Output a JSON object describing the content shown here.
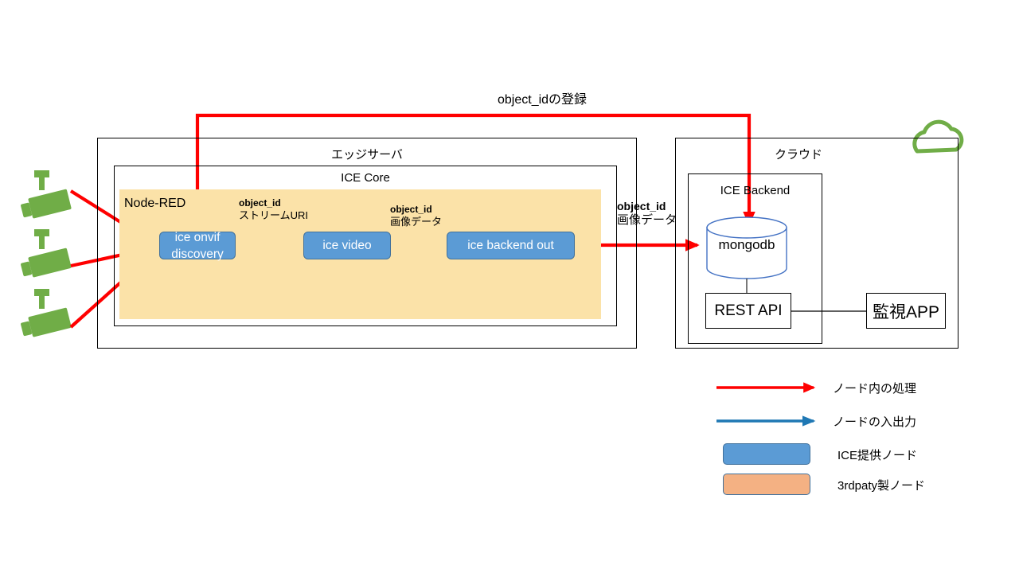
{
  "diagram": {
    "title_top_arrow": "object_idの登録",
    "edge_server": {
      "label": "エッジサーバ"
    },
    "ice_core": {
      "label": "ICE Core"
    },
    "node_red": {
      "label": "Node-RED"
    },
    "cloud": {
      "label": "クラウド"
    },
    "ice_backend": {
      "label": "ICE Backend"
    },
    "nodes": [
      {
        "id": "ice-onvif-discovery",
        "line1": "ice onvif",
        "line2": "discovery"
      },
      {
        "id": "ice-video",
        "line1": "ice video",
        "line2": ""
      },
      {
        "id": "ice-backend-out",
        "line1": "ice backend out",
        "line2": ""
      }
    ],
    "flow_labels": [
      {
        "id": "label-stream",
        "line1": "object_id",
        "line2": "ストリームURI"
      },
      {
        "id": "label-image",
        "line1": "object_id",
        "line2": "画像データ"
      },
      {
        "id": "label-image-out",
        "line1": "object_id",
        "line2": "画像データ"
      }
    ],
    "database": {
      "label": "mongodb"
    },
    "rest_api": {
      "label": "REST API"
    },
    "monitor_app": {
      "label": "監視APP"
    },
    "cameras": [
      {
        "id": "camera-1"
      },
      {
        "id": "camera-2"
      },
      {
        "id": "camera-3"
      }
    ]
  },
  "legend": {
    "items": [
      {
        "id": "legend-red-arrow",
        "kind": "arrow",
        "color": "#FF0000",
        "label": "ノード内の処理"
      },
      {
        "id": "legend-blue-arrow",
        "kind": "arrow",
        "color": "#1F78B4",
        "label": "ノードの入出力"
      },
      {
        "id": "legend-blue-swatch",
        "kind": "swatch",
        "color": "#5B9BD5",
        "label": "ICE提供ノード"
      },
      {
        "id": "legend-orange-swatch",
        "kind": "swatch",
        "color": "#F4B183",
        "label": "3rdpaty製ノード"
      }
    ]
  },
  "colors": {
    "node_blue": "#5B9BD5",
    "node_orange": "#F4B183",
    "red_arrow": "#FF0000",
    "blue_arrow": "#1F78B4",
    "yellow_area": "#FBE2A8",
    "camera_green": "#70AD47",
    "cloud_green": "#70AD47",
    "db_outline": "#4472C4"
  }
}
